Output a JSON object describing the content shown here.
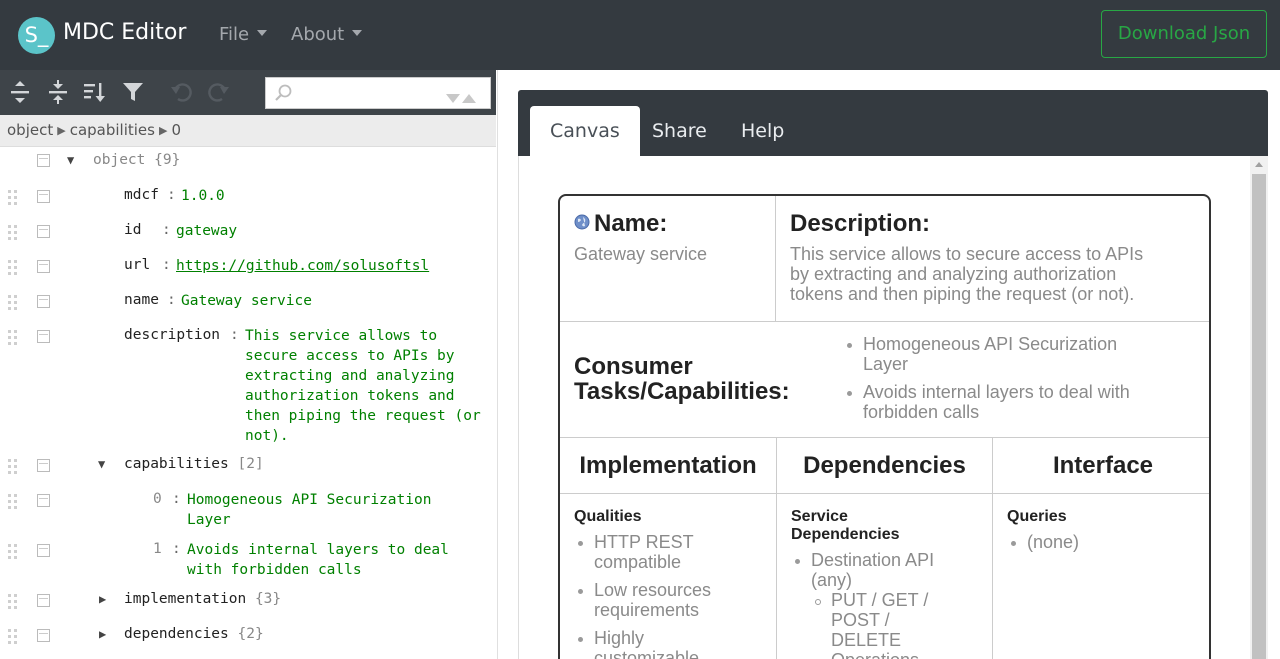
{
  "navbar": {
    "logo_text": "S_",
    "brand": "MDC Editor",
    "menus": [
      "File",
      "About"
    ],
    "download_label": "Download Json"
  },
  "editor": {
    "toolbar_icons": [
      "expand-all-icon",
      "collapse-all-icon",
      "sort-icon",
      "filter-icon",
      "undo-icon",
      "redo-icon"
    ],
    "search": {
      "placeholder": "",
      "value": ""
    },
    "breadcrumb": [
      "object",
      "capabilities",
      "0"
    ],
    "tree": {
      "root_label": "object",
      "root_count": "{9}",
      "fields": {
        "mdcf": {
          "key": "mdcf",
          "value": "1.0.0"
        },
        "id": {
          "key": "id",
          "value": "gateway"
        },
        "url": {
          "key": "url",
          "value": "https://github.com/solusoftsl"
        },
        "name": {
          "key": "name",
          "value": "Gateway service"
        },
        "description": {
          "key": "description",
          "lines": [
            "This service allows to",
            "secure access to APIs by",
            "extracting and analyzing",
            "authorization tokens and",
            "then piping the request (or",
            "not)."
          ]
        }
      },
      "capabilities": {
        "key": "capabilities",
        "count": "[2]",
        "items": [
          {
            "index": "0",
            "lines": [
              "Homogeneous API Securization",
              "Layer"
            ]
          },
          {
            "index": "1",
            "lines": [
              "Avoids internal layers to deal",
              "with forbidden calls"
            ]
          }
        ]
      },
      "implementation": {
        "key": "implementation",
        "count": "{3}"
      },
      "dependencies": {
        "key": "dependencies",
        "count": "{2}"
      }
    }
  },
  "preview": {
    "tabs": [
      "Canvas",
      "Share",
      "Help"
    ],
    "active_tab": "Canvas",
    "card": {
      "name_heading": "Name:",
      "name_value": "Gateway service",
      "description_heading": "Description:",
      "description_lines": [
        "This service allows to secure access to APIs",
        "by extracting and analyzing authorization",
        "tokens and then piping the request (or not)."
      ],
      "consumer_heading_lines": [
        "Consumer",
        "Tasks/Capabilities:"
      ],
      "capabilities": [
        {
          "lines": [
            "Homogeneous API Securization",
            "Layer"
          ]
        },
        {
          "lines": [
            "Avoids internal layers to deal with",
            "forbidden calls"
          ]
        }
      ],
      "columns": {
        "implementation": {
          "heading": "Implementation",
          "sub_heading": "Qualities",
          "items": [
            {
              "lines": [
                "HTTP REST",
                "compatible"
              ]
            },
            {
              "lines": [
                "Low resources",
                "requirements"
              ]
            },
            {
              "lines": [
                "Highly",
                "customizable"
              ]
            }
          ]
        },
        "dependencies": {
          "heading": "Dependencies",
          "sub_heading_lines": [
            "Service",
            "Dependencies"
          ],
          "item": [
            "Destination API",
            "(any)"
          ],
          "sub_item": [
            "PUT / GET /",
            "POST /",
            "DELETE",
            "Operations"
          ]
        },
        "interface": {
          "heading": "Interface",
          "sub_heading": "Queries",
          "items": [
            "(none)"
          ]
        }
      }
    }
  }
}
